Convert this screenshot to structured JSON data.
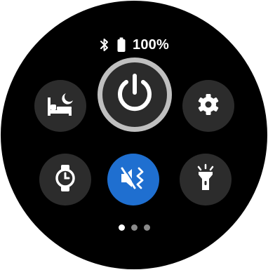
{
  "status_bar": {
    "bluetooth_icon": "bluetooth-icon",
    "battery_icon": "battery-icon",
    "battery_level": "100%"
  },
  "tiles": [
    {
      "name": "bedtime-mode-button",
      "icon": "bed-moon-icon",
      "active": false
    },
    {
      "name": "power-button",
      "icon": "power-icon",
      "active": false,
      "highlighted": true
    },
    {
      "name": "settings-button",
      "icon": "gear-icon",
      "active": false
    },
    {
      "name": "watch-only-mode-button",
      "icon": "watch-icon",
      "active": false
    },
    {
      "name": "sound-mode-button",
      "icon": "mute-vibrate-icon",
      "active": true
    },
    {
      "name": "flashlight-button",
      "icon": "flashlight-icon",
      "active": false
    }
  ],
  "pagination": {
    "total": 3,
    "current": 1
  },
  "colors": {
    "background": "#000000",
    "tile": "#2c2c2c",
    "active_tile": "#1f6fd0",
    "highlight_ring": "#bfbfbf",
    "icon": "#ffffff"
  }
}
